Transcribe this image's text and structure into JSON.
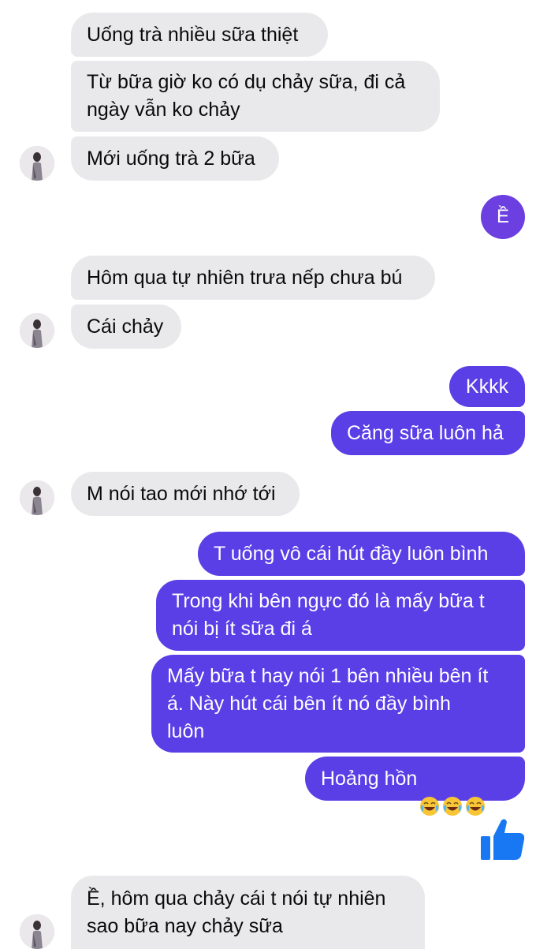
{
  "messages": [
    {
      "text": "Uống trà nhiều sữa thiệt"
    },
    {
      "text": "Từ bữa giờ ko có dụ chảy sữa, đi cả\nngày vẫn ko chảy"
    },
    {
      "text": "Mới uống trà 2 bữa"
    },
    {
      "text": "Ề"
    },
    {
      "text": "Hôm qua tự nhiên trưa nếp chưa bú"
    },
    {
      "text": "Cái chảy"
    },
    {
      "text": "Kkkk"
    },
    {
      "text": "Căng sữa luôn hả"
    },
    {
      "text": "M nói tao mới nhớ tới"
    },
    {
      "text": "T uống vô cái hút đầy luôn bình"
    },
    {
      "text": "Trong khi bên ngực đó là mấy bữa t\nnói bị ít sữa đi á"
    },
    {
      "text": "Mấy bữa t hay nói 1 bên nhiều bên ít\ná. Này hút cái bên ít nó đầy bình\nluôn"
    },
    {
      "text": "Hoảng hồn"
    },
    {
      "text": "Ề, hôm qua chảy cái t nói tự nhiên\nsao bữa nay chảy sữa"
    }
  ],
  "icons": {
    "avatar": "contact-avatar-icon",
    "laugh": "face-with-tears-of-joy-icon",
    "like": "thumbs-up-icon"
  },
  "colors": {
    "incoming_bubble": "#e9e9eb",
    "outgoing_bubble": "#5a3ee6",
    "like": "#1877f2"
  }
}
